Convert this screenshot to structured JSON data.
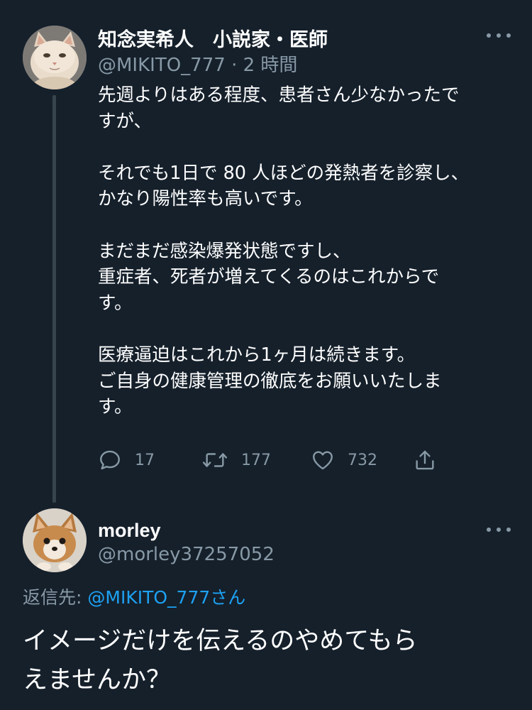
{
  "tweet": {
    "author": {
      "display_name": "知念実希人　小説家・医師",
      "handle": "@MIKITO_777",
      "separator": "·",
      "time": "2 時間"
    },
    "body_lines": [
      "先週よりはある程度、患者さん少なかったで",
      "すが、",
      "",
      "それでも1日で 80 人ほどの発熱者を診察し、",
      "かなり陽性率も高いです。",
      "",
      "まだまだ感染爆発状態ですし、",
      "重症者、死者が増えてくるのはこれからで",
      "す。",
      "",
      "医療逼迫はこれから1ヶ月は続きます。",
      "ご自身の健康管理の徹底をお願いいたしま",
      "す。"
    ],
    "actions": {
      "reply_count": "17",
      "retweet_count": "177",
      "like_count": "732"
    },
    "icons": {
      "more": "more-dots-icon",
      "reply": "reply-bubble-icon",
      "retweet": "retweet-arrows-icon",
      "like": "heart-icon",
      "share": "share-upload-icon"
    }
  },
  "reply": {
    "author": {
      "display_name": "morley",
      "handle": "@morley37257052"
    },
    "reply_to": {
      "prefix": "返信先: ",
      "mention": "@MIKITO_777",
      "suffix": "さん"
    },
    "body_lines": [
      "イメージだけを伝えるのやめてもら",
      "えませんか？"
    ]
  },
  "colors": {
    "background": "#15202b",
    "primary_text": "#ffffff",
    "secondary_text": "#8899a6",
    "link": "#1da1f2",
    "thread_line": "#38444d"
  }
}
